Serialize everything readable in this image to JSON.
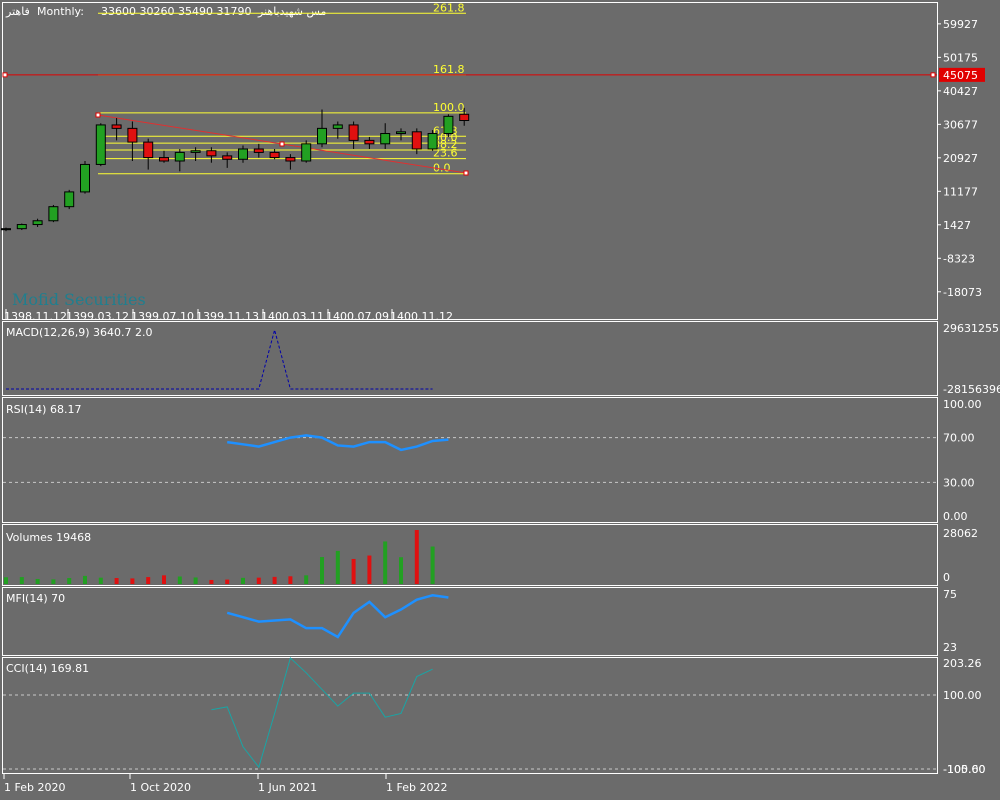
{
  "header": {
    "symbol": "فاهتر",
    "timeframe": "Monthly:",
    "ohlc": "33600 30260 35490 31790",
    "description": "مس شهیدباهنر"
  },
  "watermark": "Mofid Securities",
  "price_axis": {
    "ticks": [
      "59927",
      "50175",
      "40427",
      "30677",
      "20927",
      "11177",
      "1427",
      "-8323",
      "-18073"
    ],
    "tick_values": [
      59927,
      50175,
      40427,
      30677,
      20927,
      11177,
      1427,
      -8323,
      -18073
    ],
    "current_price_label": "45075",
    "current_price_color": "#e00000"
  },
  "fibonacci": {
    "color": "#ffff33",
    "levels": [
      "261.8",
      "161.8",
      "100.0",
      "61.8",
      "50.0",
      "38.2",
      "23.6",
      "0.0"
    ]
  },
  "main_time_labels": [
    "1398.11.12",
    "1399.03.12",
    "1399.07.10",
    "1399.11.13",
    "1400.03.11",
    "1400.07.09",
    "1400.11.12"
  ],
  "bottom_time_labels": [
    "1 Feb 2020",
    "1 Oct 2020",
    "1 Jun 2021",
    "1 Feb 2022"
  ],
  "indicators": {
    "macd": {
      "label": "MACD(12,26,9) 3640.7 2.0",
      "axis_top": "29631255",
      "axis_bottom": "-28156396"
    },
    "rsi": {
      "label": "RSI(14) 68.17",
      "ticks": [
        "100.00",
        "70.00",
        "30.00",
        "0.00"
      ]
    },
    "volumes": {
      "label": "Volumes 19468",
      "axis_top": "28062",
      "axis_bottom": "0"
    },
    "mfi": {
      "label": "MFI(14) 70",
      "axis_top": "75",
      "axis_bottom": "23"
    },
    "cci": {
      "label": "CCI(14) 169.81",
      "axis_top": "203.26",
      "ticks": [
        "100.00",
        "-100.00"
      ],
      "axis_bottom_overlap": "-105.60"
    }
  },
  "colors": {
    "background": "#6b6b6b",
    "bull": "#22a022",
    "bear": "#e01010",
    "line_blue": "#1e90ff",
    "cci_line": "#19a5a5",
    "macd_line": "#0000aa",
    "diag_line": "#e03030"
  },
  "chart_data": {
    "type": "candlestick",
    "candles": [
      {
        "o": 0,
        "h": 600,
        "l": -400,
        "c": 300
      },
      {
        "o": 300,
        "h": 1800,
        "l": -100,
        "c": 1500
      },
      {
        "o": 1500,
        "h": 3200,
        "l": 800,
        "c": 2600
      },
      {
        "o": 2600,
        "h": 7200,
        "l": 2200,
        "c": 6700
      },
      {
        "o": 6700,
        "h": 11600,
        "l": 6000,
        "c": 11000
      },
      {
        "o": 11000,
        "h": 20000,
        "l": 10500,
        "c": 19000
      },
      {
        "o": 19000,
        "h": 31000,
        "l": 18500,
        "c": 30500
      },
      {
        "o": 30500,
        "h": 32500,
        "l": 26000,
        "c": 29500
      },
      {
        "o": 29500,
        "h": 31500,
        "l": 20000,
        "c": 25500
      },
      {
        "o": 25500,
        "h": 26500,
        "l": 17500,
        "c": 21000
      },
      {
        "o": 21000,
        "h": 23000,
        "l": 19500,
        "c": 20000
      },
      {
        "o": 20000,
        "h": 23500,
        "l": 17000,
        "c": 22500
      },
      {
        "o": 22500,
        "h": 24000,
        "l": 20000,
        "c": 23000
      },
      {
        "o": 23000,
        "h": 24000,
        "l": 19500,
        "c": 21500
      },
      {
        "o": 21500,
        "h": 22500,
        "l": 18000,
        "c": 20500
      },
      {
        "o": 20500,
        "h": 24500,
        "l": 19500,
        "c": 23500
      },
      {
        "o": 23500,
        "h": 25000,
        "l": 21000,
        "c": 22500
      },
      {
        "o": 22500,
        "h": 23500,
        "l": 20500,
        "c": 21000
      },
      {
        "o": 21000,
        "h": 22000,
        "l": 17500,
        "c": 20000
      },
      {
        "o": 20000,
        "h": 26000,
        "l": 19500,
        "c": 25000
      },
      {
        "o": 25000,
        "h": 35000,
        "l": 24000,
        "c": 29500
      },
      {
        "o": 29500,
        "h": 31500,
        "l": 26500,
        "c": 30500
      },
      {
        "o": 30500,
        "h": 31500,
        "l": 23500,
        "c": 26000
      },
      {
        "o": 26000,
        "h": 27000,
        "l": 23500,
        "c": 25000
      },
      {
        "o": 25000,
        "h": 31000,
        "l": 23500,
        "c": 28000
      },
      {
        "o": 28000,
        "h": 29500,
        "l": 26000,
        "c": 28500
      },
      {
        "o": 28500,
        "h": 29500,
        "l": 22000,
        "c": 23500
      },
      {
        "o": 23500,
        "h": 29000,
        "l": 23000,
        "c": 28000
      },
      {
        "o": 28000,
        "h": 33600,
        "l": 27000,
        "c": 33000
      },
      {
        "o": 33600,
        "h": 35490,
        "l": 30260,
        "c": 31790
      }
    ],
    "ylim": [
      -26000,
      66000
    ],
    "volumes": [
      3500,
      3600,
      2600,
      2400,
      3100,
      4200,
      3300,
      3100,
      2900,
      3600,
      4500,
      3900,
      3400,
      2100,
      2300,
      3200,
      3300,
      3700,
      4000,
      4500,
      14000,
      17200,
      13000,
      14800,
      22100,
      13900,
      28062,
      19468
    ],
    "rsi_x_start": 14,
    "rsi": [
      66,
      64,
      62,
      66,
      70,
      72,
      70,
      63,
      62,
      66,
      66,
      59,
      62,
      67,
      68.17
    ],
    "mfi_x_start": 14,
    "mfi": [
      56,
      52,
      48,
      49,
      50,
      42,
      42,
      34,
      56,
      66,
      52,
      59,
      68,
      72,
      70
    ],
    "cci_x_start": 13,
    "cci": [
      60,
      68,
      -40,
      -95,
      50,
      200,
      160,
      115,
      70,
      105,
      105,
      40,
      50,
      150,
      169.81
    ],
    "macd_x": [
      0,
      16,
      17,
      18,
      27
    ],
    "macd": [
      0,
      0,
      1,
      0,
      0
    ],
    "fib_prices": {
      "261.8": 63000,
      "161.8": 45075,
      "100.0": 34000,
      "61.8": 27200,
      "50.0": 25200,
      "38.2": 23200,
      "23.6": 20700,
      "0.0": 16300
    }
  }
}
